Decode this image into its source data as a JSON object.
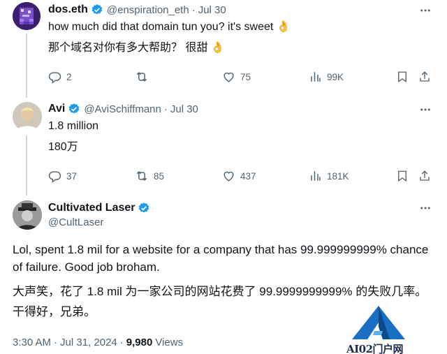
{
  "tweet1": {
    "name": "dos.eth",
    "handle": "@enspiration_eth",
    "date": "Jul 30",
    "text": "how much did that domain tun you? it's sweet 👌",
    "translation": "那个域名对你有多大帮助？ 很甜 👌",
    "replies": "2",
    "retweets": "",
    "likes": "75",
    "views": "99K"
  },
  "tweet2": {
    "name": "Avi",
    "handle": "@AviSchiffmann",
    "date": "Jul 30",
    "text": "1.8 million",
    "translation": "180万",
    "replies": "37",
    "retweets": "85",
    "likes": "437",
    "views": "181K"
  },
  "tweet3": {
    "name": "Cultivated Laser",
    "handle": "@CultLaser",
    "text": "Lol, spent 1.8 mil for a website for a company that has 99.999999999% chance of failure. Good job broham.",
    "translation": "大声笑，花了 1.8 mil 为一家公司的网站花费了 99.9999999999% 的失败几率。干得好，兄弟。",
    "time": "3:30 AM",
    "date": "Jul 31, 2024",
    "views_count": "9,980",
    "views_label": "Views"
  },
  "watermark": {
    "text": "AI02门户网"
  },
  "colors": {
    "verified": "#1d9bf0",
    "secondary": "#536471",
    "primary": "#0f1419",
    "watermark_blue": "#1a6fc4"
  }
}
